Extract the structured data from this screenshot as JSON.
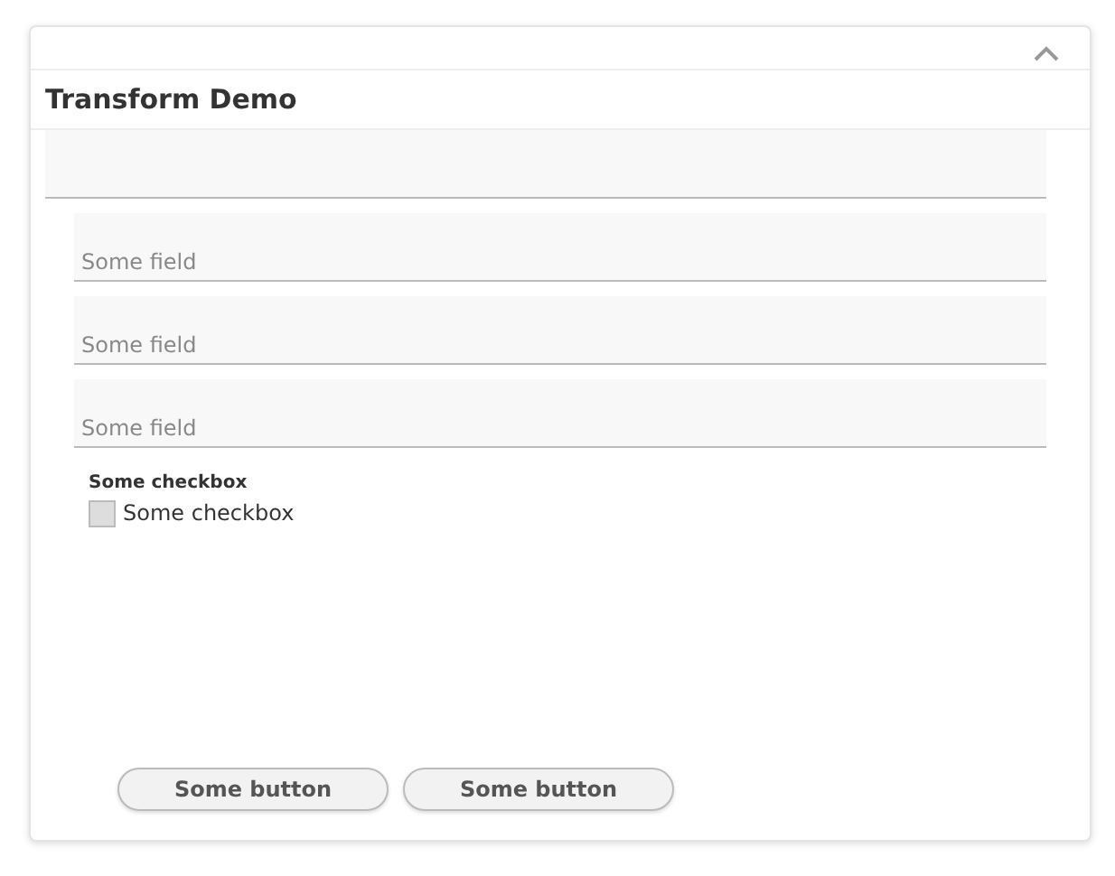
{
  "panel": {
    "title": "Transform Demo",
    "expanded": true
  },
  "fields": [
    {
      "kind": "blank"
    },
    {
      "kind": "text",
      "placeholder": "Some field"
    },
    {
      "kind": "text",
      "placeholder": "Some field"
    },
    {
      "kind": "text",
      "placeholder": "Some field"
    }
  ],
  "checkbox": {
    "heading": "Some checkbox",
    "label": "Some checkbox",
    "checked": false
  },
  "buttons": [
    "Some button",
    "Some button"
  ]
}
